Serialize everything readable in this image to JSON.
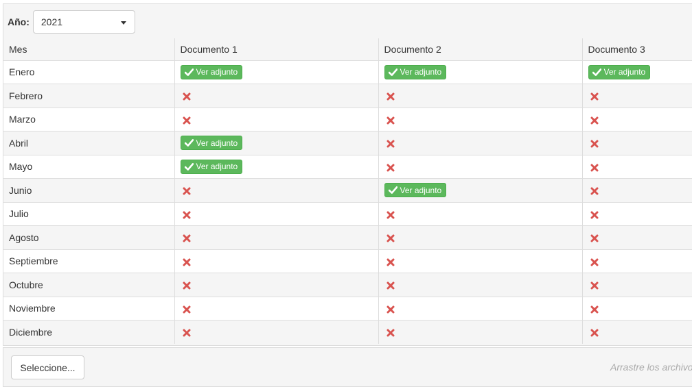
{
  "filter": {
    "year_label": "Año:",
    "year_value": "2021"
  },
  "table": {
    "headers": [
      "Mes",
      "Documento 1",
      "Documento 2",
      "Documento 3"
    ],
    "attachment_label": "Ver adjunto",
    "rows": [
      {
        "month": "Enero",
        "docs": [
          true,
          true,
          true
        ]
      },
      {
        "month": "Febrero",
        "docs": [
          false,
          false,
          false
        ]
      },
      {
        "month": "Marzo",
        "docs": [
          false,
          false,
          false
        ]
      },
      {
        "month": "Abril",
        "docs": [
          true,
          false,
          false
        ]
      },
      {
        "month": "Mayo",
        "docs": [
          true,
          false,
          false
        ]
      },
      {
        "month": "Junio",
        "docs": [
          false,
          true,
          false
        ]
      },
      {
        "month": "Julio",
        "docs": [
          false,
          false,
          false
        ]
      },
      {
        "month": "Agosto",
        "docs": [
          false,
          false,
          false
        ]
      },
      {
        "month": "Septiembre",
        "docs": [
          false,
          false,
          false
        ]
      },
      {
        "month": "Octubre",
        "docs": [
          false,
          false,
          false
        ]
      },
      {
        "month": "Noviembre",
        "docs": [
          false,
          false,
          false
        ]
      },
      {
        "month": "Diciembre",
        "docs": [
          false,
          false,
          false
        ]
      }
    ]
  },
  "upload": {
    "button_label": "Seleccione...",
    "drop_hint": "Arrastre los archivos"
  },
  "icons": {
    "present": "check-icon",
    "missing": "times-icon"
  },
  "colors": {
    "success": "#5cb85c",
    "danger": "#d9534f",
    "border": "#dddddd",
    "stripe": "#f5f5f5"
  }
}
